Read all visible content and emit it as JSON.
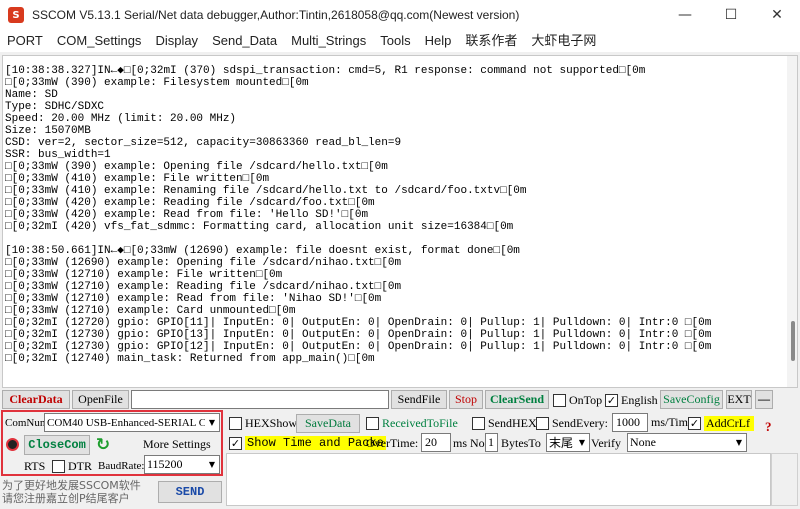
{
  "window": {
    "title": "SSCOM V5.13.1 Serial/Net data debugger,Author:Tintin,2618058@qq.com(Newest version)",
    "app_icon": "S",
    "minimize": "—",
    "maximize": "☐",
    "close": "✕"
  },
  "menu": [
    "PORT",
    "COM_Settings",
    "Display",
    "Send_Data",
    "Multi_Strings",
    "Tools",
    "Help",
    "联系作者",
    "大虾电子网"
  ],
  "log_lines": [
    "[10:38:38.327]IN←◆□[0;32mI (370) sdspi_transaction: cmd=5, R1 response: command not supported□[0m",
    "□[0;33mW (390) example: Filesystem mounted□[0m",
    "Name: SD",
    "Type: SDHC/SDXC",
    "Speed: 20.00 MHz (limit: 20.00 MHz)",
    "Size: 15070MB",
    "CSD: ver=2, sector_size=512, capacity=30863360 read_bl_len=9",
    "SSR: bus_width=1",
    "□[0;33mW (390) example: Opening file /sdcard/hello.txt□[0m",
    "□[0;33mW (410) example: File written□[0m",
    "□[0;33mW (410) example: Renaming file /sdcard/hello.txt to /sdcard/foo.txtv□[0m",
    "□[0;33mW (420) example: Reading file /sdcard/foo.txt□[0m",
    "□[0;33mW (420) example: Read from file: 'Hello SD!'□[0m",
    "□[0;32mI (420) vfs_fat_sdmmc: Formatting card, allocation unit size=16384□[0m",
    "",
    "[10:38:50.661]IN←◆□[0;33mW (12690) example: file doesnt exist, format done□[0m",
    "□[0;33mW (12690) example: Opening file /sdcard/nihao.txt□[0m",
    "□[0;33mW (12710) example: File written□[0m",
    "□[0;33mW (12710) example: Reading file /sdcard/nihao.txt□[0m",
    "□[0;33mW (12710) example: Read from file: 'Nihao SD!'□[0m",
    "□[0;33mW (12710) example: Card unmounted□[0m",
    "□[0;32mI (12720) gpio: GPIO[11]| InputEn: 0| OutputEn: 0| OpenDrain: 0| Pullup: 1| Pulldown: 0| Intr:0 □[0m",
    "□[0;32mI (12730) gpio: GPIO[13]| InputEn: 0| OutputEn: 0| OpenDrain: 0| Pullup: 1| Pulldown: 0| Intr:0 □[0m",
    "□[0;32mI (12730) gpio: GPIO[12]| InputEn: 0| OutputEn: 0| OpenDrain: 0| Pullup: 1| Pulldown: 0| Intr:0 □[0m",
    "□[0;32mI (12740) main_task: Returned from app_main()□[0m"
  ],
  "toolbar": {
    "clear_data": "ClearData",
    "open_file": "OpenFile",
    "file_path": "",
    "send_file": "SendFile",
    "stop": "Stop",
    "clear_send": "ClearSend",
    "on_top": "OnTop",
    "english": "English",
    "save_config": "SaveConfig",
    "ext": "EXT",
    "collapse": "—"
  },
  "port": {
    "comnum_label": "ComNum",
    "port_value": "COM40 USB-Enhanced-SERIAL C",
    "close_com": "CloseCom",
    "more_settings": "More Settings",
    "rts": "RTS",
    "dtr": "DTR",
    "baudrate_label": "BaudRate:",
    "baudrate": "115200",
    "send": "SEND"
  },
  "options": {
    "hex_show": "HEXShow",
    "save_data": "SaveData",
    "received_to_file": "ReceivedToFile",
    "send_hex": "SendHEX",
    "send_every": "SendEvery:",
    "send_every_value": "1000",
    "ms_tim": "ms/Tim",
    "add_crlf": "AddCrLf",
    "help_mark": "?",
    "show_time": "Show Time and Packe",
    "overtime": "OverTime:",
    "overtime_value": "20",
    "ms": "ms",
    "no": "No",
    "no_value": "1",
    "bytes_to": "BytesTo",
    "bytes_to_value": "末尾",
    "verify": "Verify",
    "verify_value": "None"
  },
  "promo": {
    "line1": "为了更好地发展SSCOM软件",
    "line2": "请您注册嘉立创P结尾客户"
  },
  "colors": {
    "highlight": "#ffff00",
    "panel_border": "#e0323c",
    "red_text": "#c00000",
    "green_text": "#008040"
  }
}
